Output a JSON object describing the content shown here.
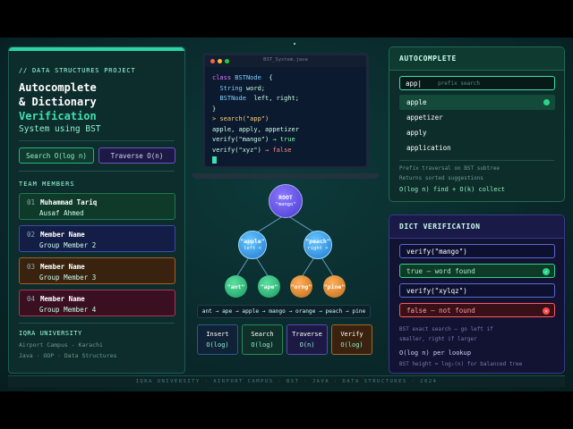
{
  "left": {
    "kicker": "// DATA STRUCTURES PROJECT",
    "title_line1": "Autocomplete",
    "title_line2": "& Dictionary",
    "title_line3": "Verification",
    "subtitle": "System using BST",
    "chip_search": "Search O(log n)",
    "chip_traverse": "Traverse O(n)",
    "team_heading": "TEAM MEMBERS",
    "members": [
      {
        "num": "01",
        "name": "Muhammad Tariq",
        "role": "Ausaf Ahmed"
      },
      {
        "num": "02",
        "name": "Member Name",
        "role": "Group Member 2"
      },
      {
        "num": "03",
        "name": "Member Name",
        "role": "Group Member 3"
      },
      {
        "num": "04",
        "name": "Member Name",
        "role": "Group Member 4"
      }
    ],
    "university": "IQRA UNIVERSITY",
    "campus": "Airport Campus - Karachi",
    "tags": "Java · OOP · Data Structures"
  },
  "editor": {
    "filename": "BST_System.java",
    "line1_kw": "class",
    "line1_name": "BSTNode",
    "line1_brace": "{",
    "line2_type": "String",
    "line2_var": "word;",
    "line3_type": "BSTNode",
    "line3_var": "left, right;",
    "line4": "}",
    "line5_prompt": ">",
    "line5_call": "search(\"app\")",
    "line6": "apple, apply, appetizer",
    "line7_call": "verify(\"mango\")",
    "line7_res": "→ true",
    "line8_call": "verify(\"xyz\")",
    "line8_res": "→ false"
  },
  "tree": {
    "root_label": "ROOT",
    "root_word": "\"mango\"",
    "left_word": "\"apple\"",
    "left_note": "left <",
    "right_word": "\"peach\"",
    "right_note": "right >",
    "leaves": [
      "\"ant\"",
      "\"ape\"",
      "\"orng\"",
      "\"pine\""
    ],
    "inorder": "ant → ape → apple → mango → orange → peach → pine"
  },
  "ops": [
    {
      "name": "Insert",
      "cx": "O(log)"
    },
    {
      "name": "Search",
      "cx": "O(log)"
    },
    {
      "name": "Traverse",
      "cx": "O(n)"
    },
    {
      "name": "Verify",
      "cx": "O(log)"
    }
  ],
  "autocomplete": {
    "heading": "AUTOCOMPLETE",
    "input_value": "app|",
    "input_hint": "prefix search",
    "suggestions": [
      "apple",
      "appetizer",
      "apply",
      "application"
    ],
    "note1": "Prefix traversal on BST subtree",
    "note2": "Returns sorted suggestions",
    "complexity": "O(log n) find + O(k) collect"
  },
  "dict": {
    "heading": "DICT VERIFICATION",
    "q1": "verify(\"mango\")",
    "r1": "true — word found",
    "q2": "verify(\"xylqz\")",
    "r2": "false — not found",
    "note1": "BST exact search — go left if",
    "note2": "smaller, right if larger",
    "complexity": "O(log n) per lookup",
    "note3": "BST height = log₂(n) for balanced tree"
  },
  "footer": "IQRA UNIVERSITY · AIRPORT CAMPUS · BST · JAVA · DATA STRUCTURES · 2024"
}
